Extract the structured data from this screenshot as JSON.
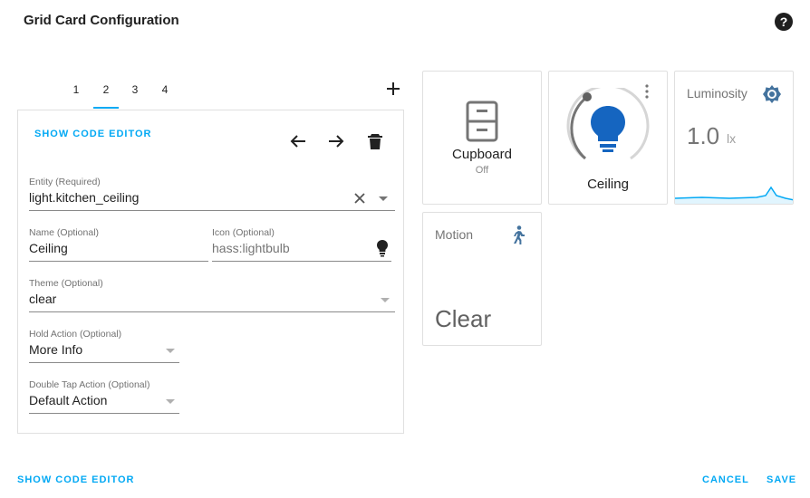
{
  "dialog": {
    "title": "Grid Card Configuration"
  },
  "tabs": [
    "1",
    "2",
    "3",
    "4"
  ],
  "editor": {
    "show_code_editor": "SHOW CODE EDITOR",
    "fields": {
      "entity": {
        "label": "Entity (Required)",
        "value": "light.kitchen_ceiling"
      },
      "name": {
        "label": "Name (Optional)",
        "value": "Ceiling"
      },
      "icon": {
        "label": "Icon (Optional)",
        "placeholder": "hass:lightbulb"
      },
      "theme": {
        "label": "Theme (Optional)",
        "value": "clear"
      },
      "hold_action": {
        "label": "Hold Action (Optional)",
        "value": "More Info"
      },
      "double_tap_action": {
        "label": "Double Tap Action (Optional)",
        "value": "Default Action"
      }
    }
  },
  "preview": {
    "cupboard": {
      "name": "Cupboard",
      "state": "Off"
    },
    "ceiling": {
      "name": "Ceiling"
    },
    "luminosity": {
      "name": "Luminosity",
      "value": "1.0",
      "unit": "lx"
    },
    "motion": {
      "name": "Motion",
      "state": "Clear"
    }
  },
  "footer": {
    "show_code_editor": "SHOW CODE EDITOR",
    "cancel": "CANCEL",
    "save": "SAVE"
  },
  "colors": {
    "accent": "#03a9f4",
    "icon_blue": "#1565c0",
    "state_icon": "#44739e"
  }
}
